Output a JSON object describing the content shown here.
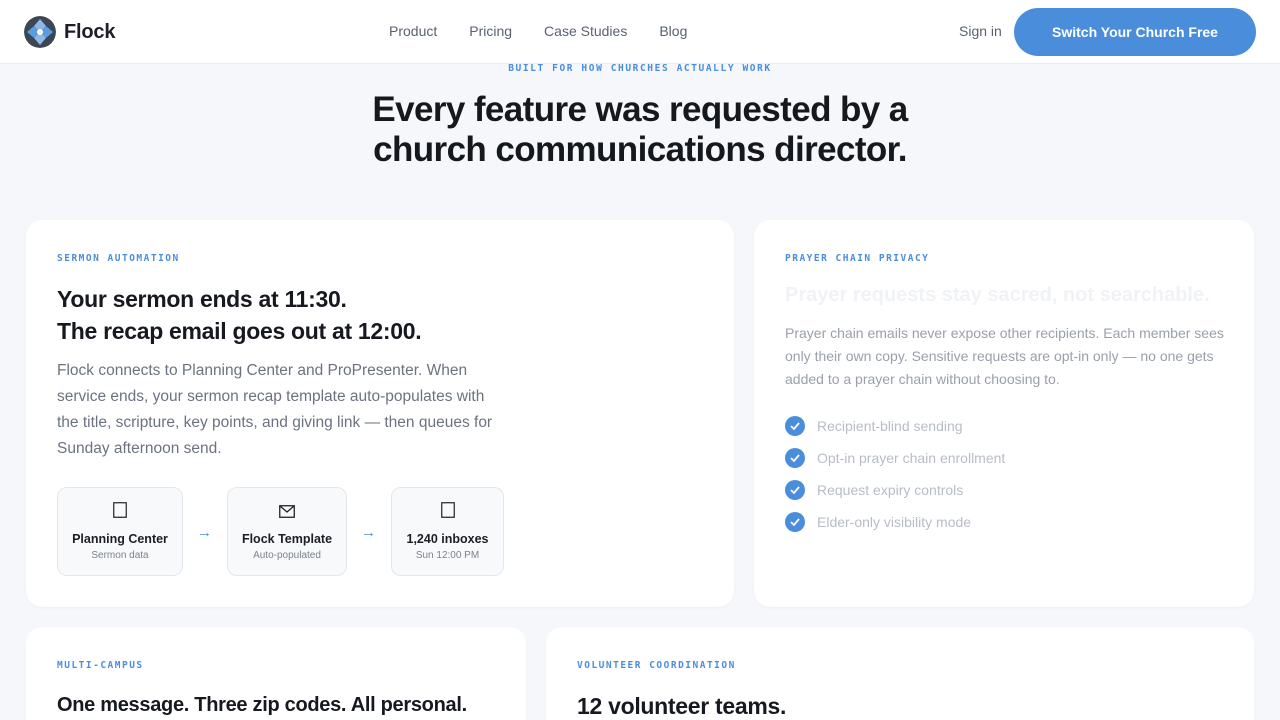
{
  "brand": {
    "name": "Flock"
  },
  "nav": {
    "links": [
      "Product",
      "Pricing",
      "Case Studies",
      "Blog"
    ],
    "signin": "Sign in",
    "cta": "Switch Your Church Free"
  },
  "hero": {
    "eyebrow": "BUILT FOR HOW CHURCHES ACTUALLY WORK",
    "title_line1": "Every feature was requested by a",
    "title_line2": "church communications director."
  },
  "sermon": {
    "label": "SERMON AUTOMATION",
    "title_line1": "Your sermon ends at 11:30.",
    "title_line2": "The recap email goes out at 12:00.",
    "body": "Flock connects to Planning Center and ProPresenter. When service ends, your sermon recap template auto-populates with the title, scripture, key points, and giving link — then queues for Sunday afternoon send.",
    "flow": [
      {
        "icon": "calendar-icon",
        "name": "Planning Center",
        "sub": "Sermon data"
      },
      {
        "icon": "envelope-icon",
        "name": "Flock Template",
        "sub": "Auto-populated"
      },
      {
        "icon": "inbox-icon",
        "name": "1,240 inboxes",
        "sub": "Sun 12:00 PM"
      }
    ],
    "arrow": "→"
  },
  "prayer": {
    "label": "PRAYER CHAIN PRIVACY",
    "title": "Prayer requests stay sacred, not searchable.",
    "body": "Prayer chain emails never expose other recipients. Each member sees only their own copy. Sensitive requests are opt-in only — no one gets added to a prayer chain without choosing to.",
    "checks": [
      "Recipient-blind sending",
      "Opt-in prayer chain enrollment",
      "Request expiry controls",
      "Elder-only visibility mode"
    ]
  },
  "campus": {
    "label": "MULTI-CAMPUS",
    "title": "One message. Three zip codes. All personal."
  },
  "volunteer": {
    "label": "VOLUNTEER COORDINATION",
    "title": "12 volunteer teams."
  },
  "colors": {
    "accent": "#4a8edb",
    "background": "#f5f7fa",
    "card": "#ffffff"
  }
}
